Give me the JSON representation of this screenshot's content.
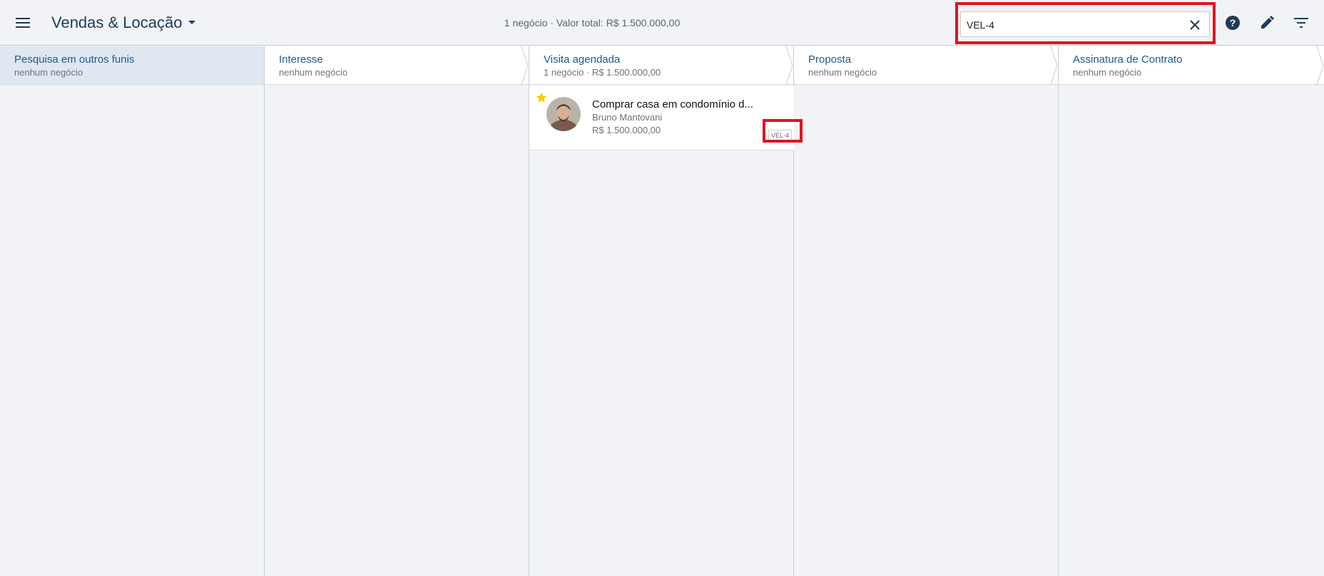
{
  "header": {
    "app_title": "Vendas & Locação",
    "summary": "1 negócio · Valor total: R$ 1.500.000,00",
    "search": {
      "value": "VEL-4",
      "placeholder": ""
    }
  },
  "icons": {
    "menu": "menu-icon",
    "dropdown": "caret-down-icon",
    "clear": "close-icon",
    "help": "help-circle-icon",
    "edit": "pencil-icon",
    "filter": "filter-icon"
  },
  "columns": [
    {
      "name": "Pesquisa em outros funis",
      "subtitle": "nenhum negócio",
      "active": true
    },
    {
      "name": "Interesse",
      "subtitle": "nenhum negócio",
      "active": false
    },
    {
      "name": "Visita agendada",
      "subtitle": "1 negócio · R$ 1.500.000,00",
      "active": false
    },
    {
      "name": "Proposta",
      "subtitle": "nenhum negócio",
      "active": false
    },
    {
      "name": "Assinatura de Contrato",
      "subtitle": "nenhum negócio",
      "active": false
    }
  ],
  "deal_card": {
    "title": "Comprar casa em condomínio d...",
    "person": "Bruno Mantovani",
    "value": "R$ 1.500.000,00",
    "code": "VEL-4",
    "starred": true
  },
  "colors": {
    "accent": "#1e5a8a",
    "highlight": "#e0141e",
    "star": "#f5d000",
    "active_column": "#dfe8f0"
  }
}
